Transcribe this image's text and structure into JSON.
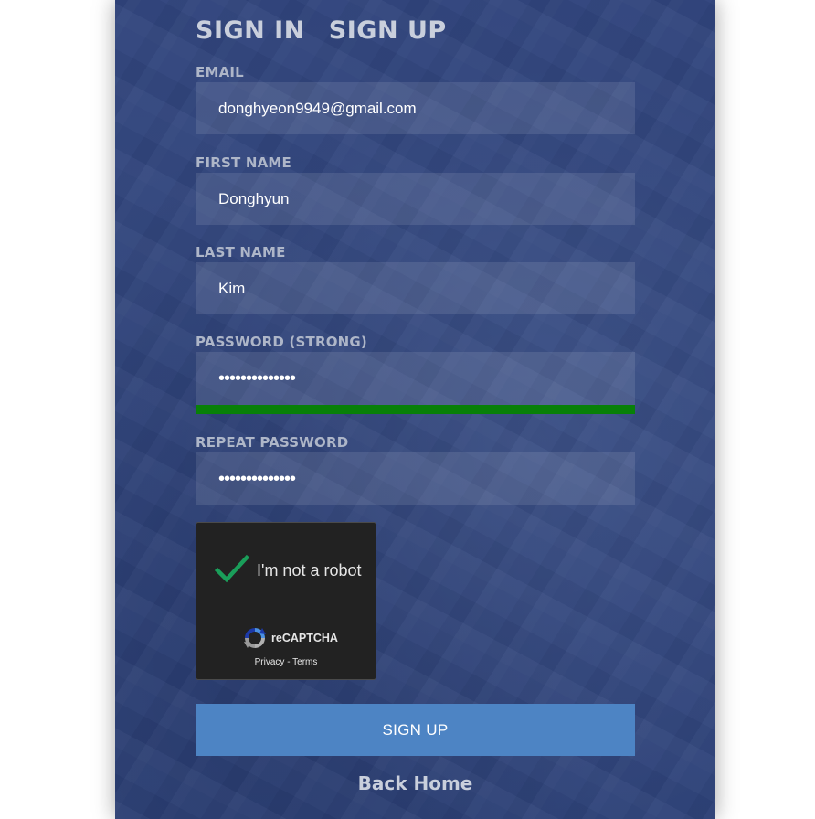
{
  "tabs": {
    "sign_in": "SIGN IN",
    "sign_up": "SIGN UP"
  },
  "form": {
    "email": {
      "label": "EMAIL",
      "value": "donghyeon9949@gmail.com"
    },
    "first_name": {
      "label": "FIRST NAME",
      "value": "Donghyun"
    },
    "last_name": {
      "label": "LAST NAME",
      "value": "Kim"
    },
    "password": {
      "label": "PASSWORD (STRONG)",
      "value": "••••••••••••••",
      "strength_fraction": 1.0,
      "strength_color": "#088008"
    },
    "repeat_password": {
      "label": "REPEAT PASSWORD",
      "value": "••••••••••••••"
    }
  },
  "captcha": {
    "label": "I'm not a robot",
    "brand": "reCAPTCHA",
    "privacy": "Privacy",
    "separator": " - ",
    "terms": "Terms",
    "checked": true,
    "check_color": "#1a9e5a",
    "icon": "recaptcha-logo-icon"
  },
  "actions": {
    "sign_up_button": "SIGN UP",
    "back_home": "Back Home"
  },
  "colors": {
    "panel": "#3d5185",
    "button": "#4d84c4"
  }
}
